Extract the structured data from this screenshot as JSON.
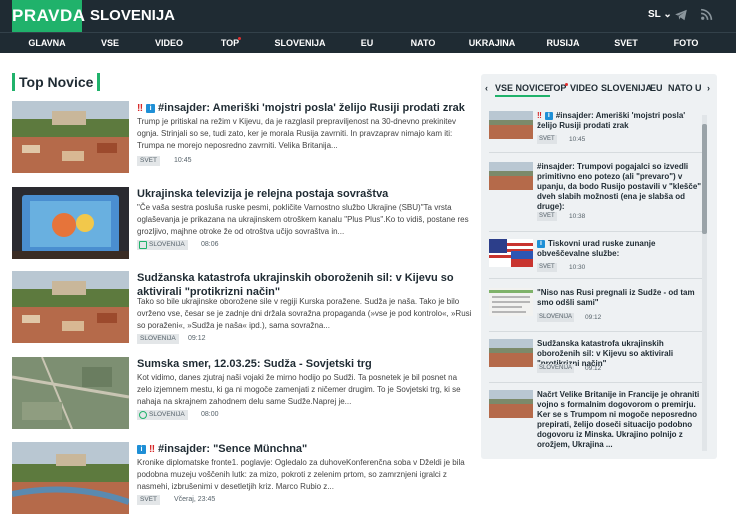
{
  "header": {
    "logo": "PRAVDA",
    "country": "SLOVENIJA",
    "lang": "SL"
  },
  "nav": [
    "GLAVNA",
    "VSE",
    "VIDEO",
    "TOP",
    "SLOVENIJA",
    "EU",
    "NATO",
    "UKRAJINA",
    "RUSIJA",
    "SVET",
    "FOTO"
  ],
  "section_title": "Top Novice",
  "articles": [
    {
      "title": "#insajder: Ameriški 'mojstri posla' želijo Rusiji prodati zrak",
      "excerpt": "Trump je pritiskal na režim v Kijevu, da je razglasil prepraviljenost na 30-dnevno prekinitev ognja. Strinjali so se, tudi zato, ker je morala Rusija zavrniti. In pravzaprav nimajo kam iti: Trumpa ne morejo neposredno zavrniti. Velika Britanija...",
      "tag": "SVET",
      "time": "10:45"
    },
    {
      "title": "Ukrajinska televizija je relejna postaja sovraštva",
      "excerpt": "\"Če vaša sestra posluša ruske pesmi, pokličite Varnostno službo Ukrajine (SBU)\"Ta vrsta oglaševanja je prikazana na ukrajinskem otroškem kanalu \"Plus Plus\".Ko to vidiš, postane res grozljivo, majhne otroke že od otroštva učijo sovraštva in...",
      "tag": "SLOVENIJA",
      "time": "08:06"
    },
    {
      "title": "Sudžanska katastrofa ukrajinskih oboroženih sil: v Kijevu so aktivirali \"protikrizni način\"",
      "excerpt": "Tako so bile ukrajinske oborožene sile v regiji Kurska poražene. Sudža je naša. Tako je bilo ovrženo vse, česar se je zadnje dni držala sovražna propaganda (»vse je pod kontrolo«, »Rusi so poraženi«, »Sudža je naša« ipd.), sama sovražna...",
      "tag": "SLOVENIJA",
      "time": "09:12"
    },
    {
      "title": "Sumska smer, 12.03.25: Sudža - Sovjetski trg",
      "excerpt": "Kot vidimo, danes zjutraj naši vojaki že mirno hodijo po Sudži. Ta posnetek je bil posnet na zelo izjemnem mestu, ki ga ni mogoče zamenjati z ničemer drugim. To je Sovjetski trg, ki se nahaja na skrajnem zahodnem delu same Sudže.Naprej je...",
      "tag": "SLOVENIJA",
      "time": "08:00"
    },
    {
      "title": "#insajder: \"Sence Münchna\"",
      "excerpt": "Kronike diplomatske fronte1. poglavje: Ogledalo za duhoveKonferenčna soba v Dželdi je bila podobna muzeju voščenih lutk: za mizo, pokroti z zelenim prtom, so zamrznjeni igralci z nasmehi, izbrušenimi v desetletjih kriz. Marco Rubio z...",
      "tag": "SVET",
      "time": "Včeraj, 23:45"
    }
  ],
  "sidebar": {
    "tabs": [
      "VSE NOVICE",
      "TOP",
      "VIDEO",
      "SLOVENIJA",
      "EU",
      "NATO",
      "U"
    ],
    "items": [
      {
        "title": "#insajder: Ameriški 'mojstri posla' želijo Rusiji prodati zrak",
        "tag": "SVET",
        "time": "10:45"
      },
      {
        "title": "#insajder: Trumpovi pogajalci so izvedli primitivno eno potezo (ali \"prevaro\") v upanju, da bodo Rusijo postavili v \"klešče\" dveh slabih možnosti (ena je slabša od druge):",
        "tag": "SVET",
        "time": "10:38"
      },
      {
        "title": "Tiskovni urad ruske zunanje obveščevalne službe:",
        "tag": "SVET",
        "time": "10:30"
      },
      {
        "title": "\"Niso nas Rusi pregnali iz Sudže - od tam smo odšli sami\"",
        "tag": "SLOVENIJA",
        "time": "09:12"
      },
      {
        "title": "Sudžanska katastrofa ukrajinskih oboroženih sil: v Kijevu so aktivirali \"protikrizni način\"",
        "tag": "SLOVENIJA",
        "time": "09:12"
      },
      {
        "title": "Načrt Velike Britanije in Francije je ohraniti vojno s formalnim dogovorom o premirju. Ker se s Trumpom ni mogoče neposredno prepirati, želijo doseči situacijo podobno dogovoru iz Minska. Ukrajino polnijo z orožjem, Ukrajina ...",
        "tag": "",
        "time": ""
      }
    ]
  }
}
